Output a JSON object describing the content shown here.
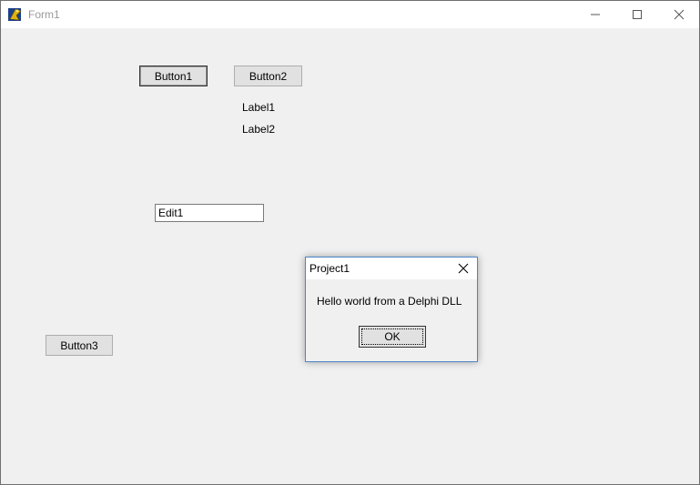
{
  "window": {
    "title": "Form1",
    "icon": "delphi-app-icon",
    "controls": [
      "minimize-icon",
      "maximize-icon",
      "close-icon"
    ]
  },
  "form": {
    "button1": "Button1",
    "button2": "Button2",
    "button3": "Button3",
    "label1": "Label1",
    "label2": "Label2",
    "edit1_value": "Edit1"
  },
  "dialog": {
    "title": "Project1",
    "message": "Hello world from a Delphi DLL",
    "ok_label": "OK",
    "border_color": "#4a86c7"
  }
}
